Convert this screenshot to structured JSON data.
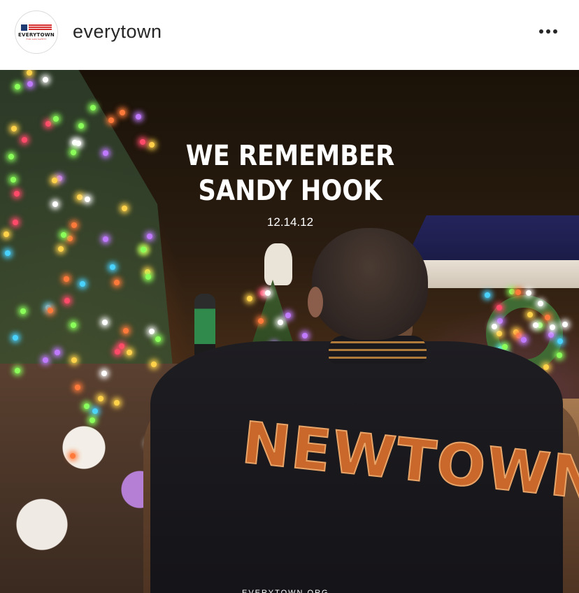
{
  "post": {
    "username": "everytown",
    "avatar": {
      "logo_text": "EVERYTOWN",
      "logo_subtext": "FOR GUN SAFETY"
    },
    "more_icon": "more-horizontal-icon"
  },
  "image": {
    "headline_line1": "WE REMEMBER",
    "headline_line2": "SANDY HOOK",
    "date": "12.14.12",
    "jacket_text": "NEWTOWN",
    "footer_text": "EVERYTOWN.ORG"
  }
}
